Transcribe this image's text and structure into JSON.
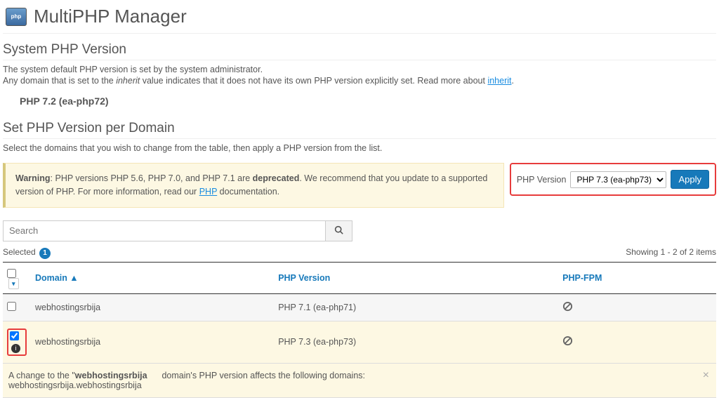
{
  "header": {
    "title": "MultiPHP Manager"
  },
  "system_version": {
    "heading": "System PHP Version",
    "desc1_a": "The system default PHP version is set by the system administrator.",
    "desc2_a": "Any domain that is set to the ",
    "desc2_em": "inherit",
    "desc2_b": " value indicates that it does not have its own PHP version explicitly set. Read more about ",
    "desc2_link": "inherit",
    "desc2_c": ".",
    "value": "PHP 7.2 (ea-php72)"
  },
  "per_domain": {
    "heading": "Set PHP Version per Domain",
    "desc": "Select the domains that you wish to change from the table, then apply a PHP version from the list."
  },
  "warning": {
    "prefix": "Warning",
    "text_a": ": PHP versions PHP 5.6, PHP 7.0, and PHP 7.1 are ",
    "text_b": "deprecated",
    "text_c": ". We recommend that you update to a supported version of PHP. For more information, read our ",
    "link": "PHP",
    "text_d": " documentation."
  },
  "apply": {
    "label": "PHP Version",
    "selected": "PHP 7.3 (ea-php73)",
    "button": "Apply"
  },
  "search": {
    "placeholder": "Search"
  },
  "meta": {
    "selected_label": "Selected",
    "selected_count": "1",
    "showing_a": "Showing ",
    "showing_b": "1 - 2 of 2 items"
  },
  "table": {
    "col_domain": "Domain ▲",
    "col_php": "PHP Version",
    "col_fpm": "PHP-FPM",
    "rows": [
      {
        "domain": "webhostingsrbija",
        "php": "PHP 7.1 (ea-php71)",
        "checked": false
      },
      {
        "domain": "webhostingsrbija",
        "php": "PHP 7.3 (ea-php73)",
        "checked": true
      }
    ]
  },
  "notice": {
    "text_a": "A change to the \"",
    "domain": "webhostingsrbija",
    "text_b": "domain's PHP version affects the following domains:",
    "sub": "webhostingsrbija.webhostingsrbija"
  }
}
